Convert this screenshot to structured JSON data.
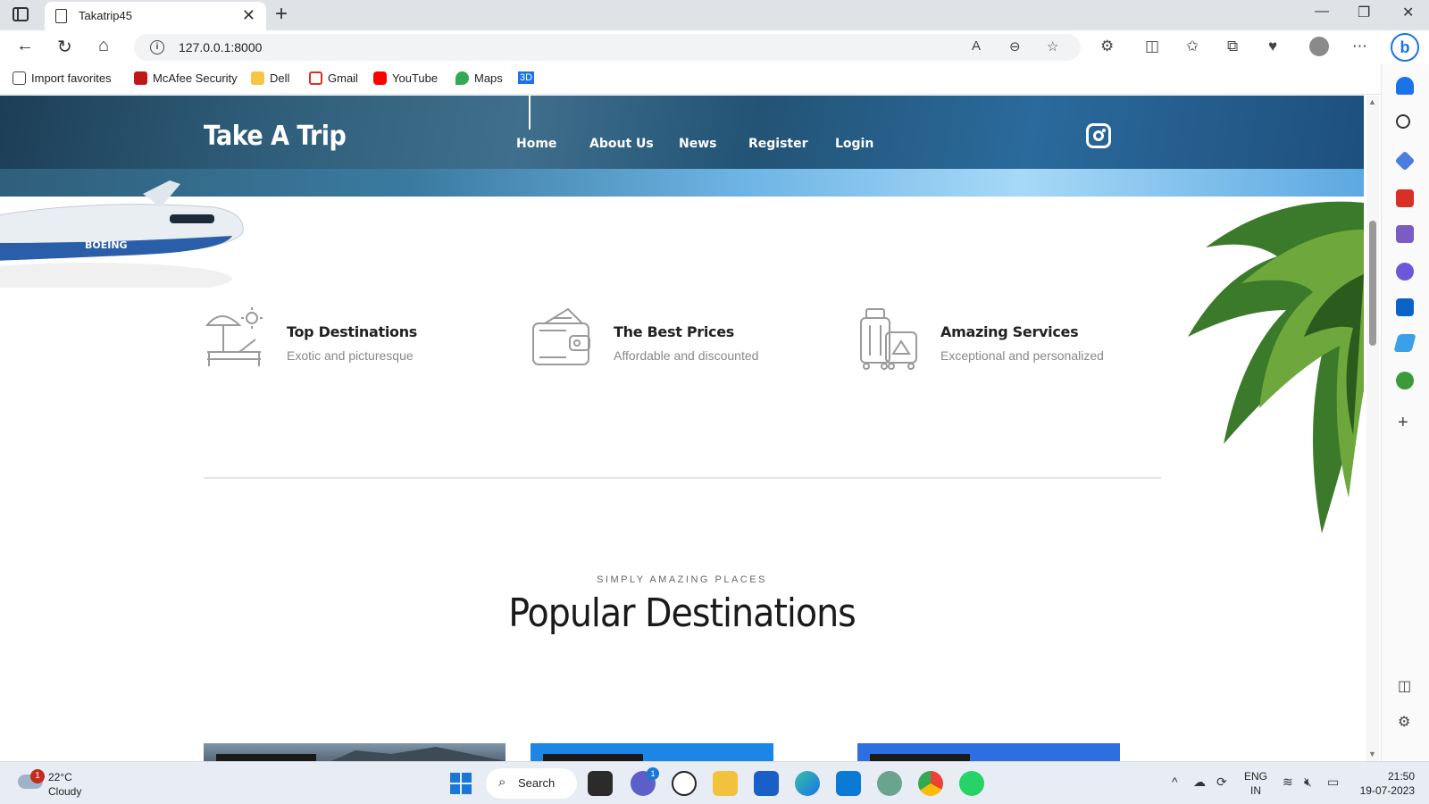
{
  "browser": {
    "tab_title": "Takatrip45",
    "url": "127.0.0.1:8000",
    "favorites": [
      "Import favorites",
      "McAfee Security",
      "Dell",
      "Gmail",
      "YouTube",
      "Maps",
      "3D"
    ]
  },
  "site": {
    "logo": "Take A Trip",
    "nav": [
      "Home",
      "About Us",
      "News",
      "Register",
      "Login"
    ],
    "active_nav": "Home",
    "features": [
      {
        "title": "Top Destinations",
        "subtitle": "Exotic and picturesque",
        "icon": "beach-umbrella-icon"
      },
      {
        "title": "The Best Prices",
        "subtitle": "Affordable and discounted",
        "icon": "wallet-icon"
      },
      {
        "title": "Amazing Services",
        "subtitle": "Exceptional and personalized",
        "icon": "luggage-icon"
      }
    ],
    "section": {
      "eyebrow": "SIMPLY AMAZING PLACES",
      "title": "Popular Destinations"
    }
  },
  "taskbar": {
    "weather_temp": "22°C",
    "weather_condition": "Cloudy",
    "weather_badge": "1",
    "search_label": "Search",
    "chat_badge": "1",
    "lang_line1": "ENG",
    "lang_line2": "IN",
    "time": "21:50",
    "date": "19-07-2023"
  },
  "colors": {
    "hero_dark": "#1d3e57",
    "hero_sky": "#6fb5e6",
    "accent_blue": "#1a78d4"
  }
}
